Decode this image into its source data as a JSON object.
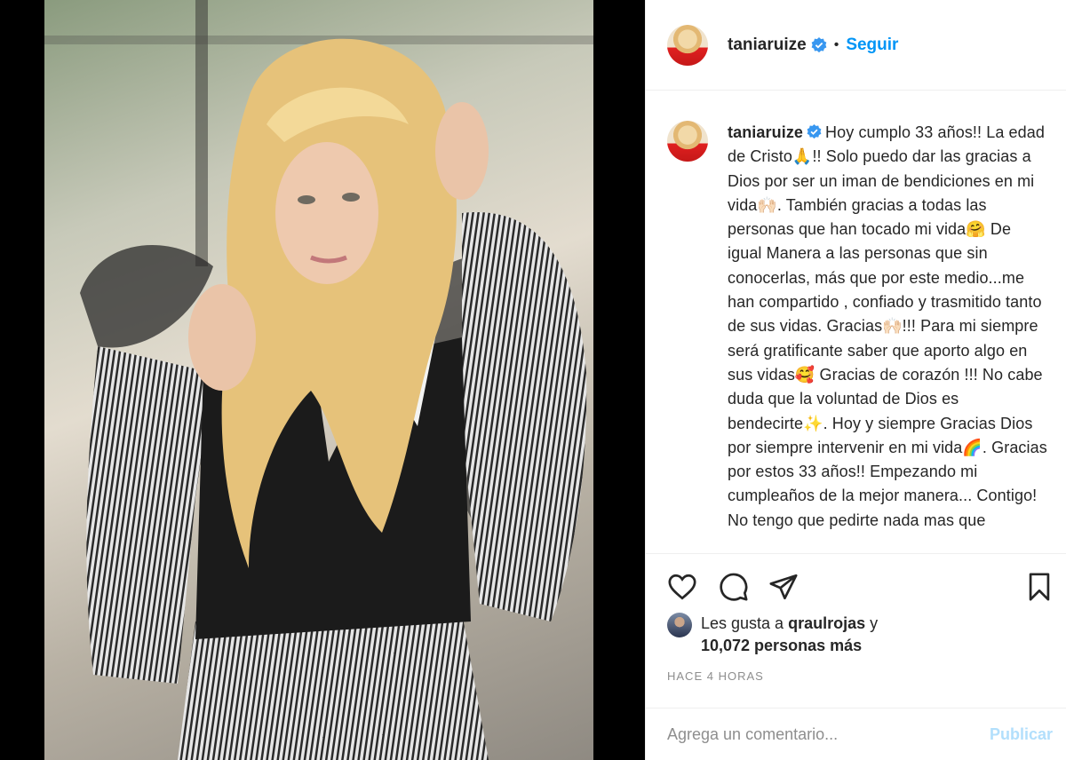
{
  "post": {
    "username": "taniaruize",
    "follow_label": "Seguir",
    "separator": "•",
    "caption": "Hoy cumplo 33 años!! La edad de Cristo🙏!! Solo puedo dar las gracias a Dios por ser un iman de bendiciones en mi vida🙌🏻. También gracias a todas las personas que han tocado mi vida🤗 De igual Manera a las personas que sin conocerlas, más que por este medio...me han compartido , confiado y trasmitido tanto de sus vidas. Gracias🙌🏻!!! Para mi siempre será gratificante saber que aporto algo en sus vidas🥰 Gracias de corazón !!! No cabe duda que la voluntad de Dios es bendecirte✨. Hoy y siempre Gracias Dios por siempre intervenir en mi vida🌈. Gracias por estos 33 años!! Empezando mi cumpleaños de la mejor manera... Contigo! No tengo que pedirte nada mas que",
    "likes_prefix": "Les gusta a ",
    "liker": "qraulrojas",
    "likes_and": " y",
    "likes_count": "10,072 personas más",
    "timestamp": "HACE 4 HORAS"
  },
  "comment": {
    "placeholder": "Agrega un comentario...",
    "publish_label": "Publicar"
  },
  "icons": {
    "like": "heart-icon",
    "comment": "comment-icon",
    "share": "paper-plane-icon",
    "save": "bookmark-icon",
    "verified": "verified-badge-icon"
  },
  "colors": {
    "accent": "#0095f6",
    "publish_disabled": "#b2dffc",
    "verified": "#3897f0"
  }
}
